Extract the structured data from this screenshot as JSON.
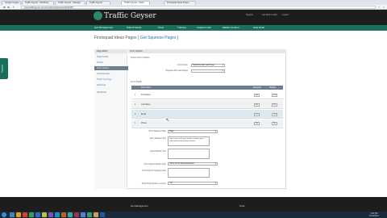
{
  "browser": {
    "tabs": [
      {
        "label": "Google Images"
      },
      {
        "label": "Traffic Geyser - Distribute"
      },
      {
        "label": "Traffic Geyser - Manage"
      },
      {
        "label": "Traffic Geyser"
      },
      {
        "label": "Traffic Geyser - Dash"
      },
      {
        "label": "Firstsquad Ideas Pages"
      }
    ],
    "url": "www.trafficgeyser.com/members/squeeze/edit/12345"
  },
  "site": {
    "brand": "Traffic Geyser",
    "top_links": [
      "Support",
      "Get More Leads",
      "Logout"
    ],
    "nav": [
      "Get Management",
      "Submit Media",
      "Tools",
      "Training",
      "Capture Lists",
      "Market Content",
      "Help Desk"
    ],
    "feedback_label": "Support"
  },
  "page": {
    "title_prefix": "Firstsquad Ideas Pages",
    "title_link": "[ Get Squeeze Pages ]"
  },
  "sidebar": {
    "header": "Page Editor",
    "items": [
      {
        "label": "Page Details"
      },
      {
        "label": "Design"
      },
      {
        "label": "Form Options"
      },
      {
        "label": "Autoresponder"
      },
      {
        "label": "Thank You Page"
      },
      {
        "label": "Advanced"
      },
      {
        "label": "Add Media"
      }
    ]
  },
  "form": {
    "header": "Form Options",
    "section_optin": "Opt-in Form Options",
    "form_action_label": "Form Action",
    "form_action_value": "Subscribe with Lead Page",
    "integrate_label": "Integrate with Lead Pages",
    "integrate_value": "",
    "section_fields": "Form Fields",
    "col_field": "Field Name",
    "col_required": "Required",
    "col_show": "Display",
    "fields": [
      {
        "num": "1",
        "name": "First Name",
        "required": "No",
        "show": "Yes"
      },
      {
        "num": "2",
        "name": "Last Name",
        "required": "No",
        "show": "No"
      },
      {
        "num": "3",
        "name": "Email",
        "required": "Yes",
        "show": "Yes"
      },
      {
        "num": "4",
        "name": "Phone",
        "required": "No",
        "show": "No"
      }
    ],
    "redirect_label": "Form Redirect Page",
    "redirect_value": "Page",
    "redirect_text_label": "Form Redirect Text",
    "redirect_text_value": "Great now check your email to confirm your subscription and get your content",
    "submit_label": "Submit Button Text",
    "submit_value": "",
    "style_label": "Form Submit Button Style",
    "style_value": "Yellow Arrow Rounded Bottom",
    "tracking_label": "Form Submit Tracking Code",
    "tracking_value": "",
    "auto_label": "Show Thank Button on Form",
    "auto_value": "Yes"
  },
  "footer": {
    "col1": "Get Management",
    "col2": "Tools"
  },
  "taskbar": {
    "time": "1:23 PM",
    "date": "10/11/2013"
  }
}
